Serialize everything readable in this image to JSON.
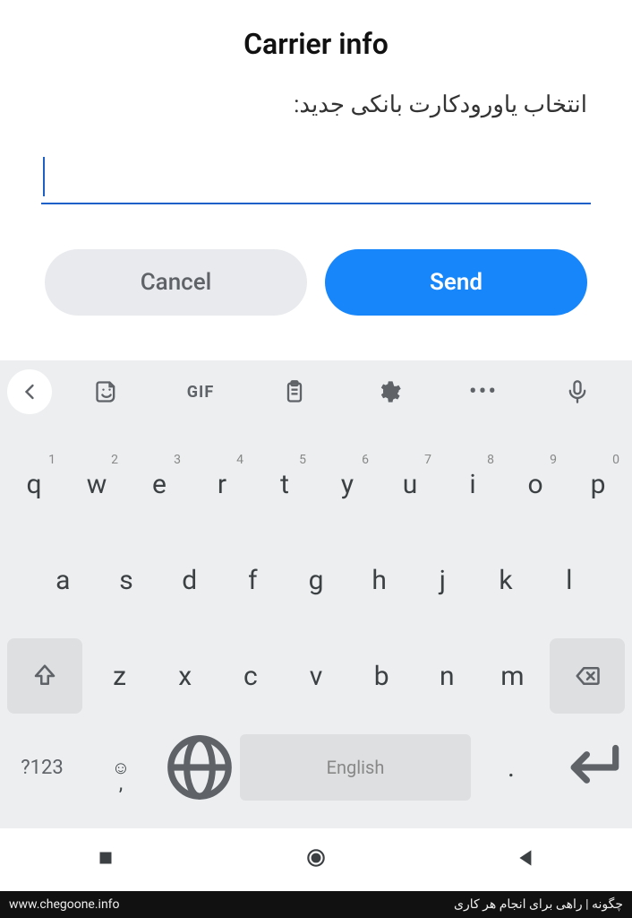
{
  "dialog": {
    "title": "Carrier info",
    "prompt": "انتخاب یاورودکارت بانکی جدید:",
    "input_value": "",
    "cancel": "Cancel",
    "send": "Send"
  },
  "keyboard": {
    "toolbar": {
      "gif": "GIF",
      "dots": "•••"
    },
    "row1": [
      {
        "k": "q",
        "h": "1"
      },
      {
        "k": "w",
        "h": "2"
      },
      {
        "k": "e",
        "h": "3"
      },
      {
        "k": "r",
        "h": "4"
      },
      {
        "k": "t",
        "h": "5"
      },
      {
        "k": "y",
        "h": "6"
      },
      {
        "k": "u",
        "h": "7"
      },
      {
        "k": "i",
        "h": "8"
      },
      {
        "k": "o",
        "h": "9"
      },
      {
        "k": "p",
        "h": "0"
      }
    ],
    "row2": [
      "a",
      "s",
      "d",
      "f",
      "g",
      "h",
      "j",
      "k",
      "l"
    ],
    "row3": [
      "z",
      "x",
      "c",
      "v",
      "b",
      "n",
      "m"
    ],
    "symbols": "?123",
    "comma": ",",
    "space": "English",
    "period": "."
  },
  "footer": {
    "url": "www.chegoone.info",
    "tagline": "چگونه | راهی برای انجام هر کاری"
  }
}
